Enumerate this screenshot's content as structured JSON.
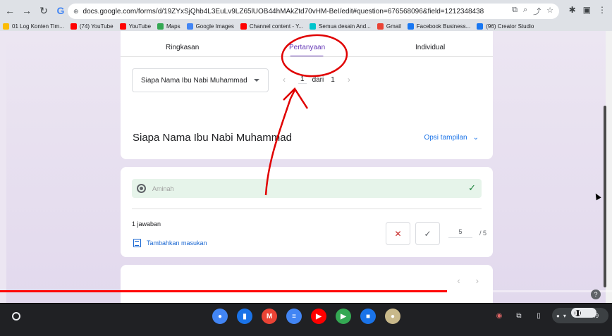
{
  "browser": {
    "url": "docs.google.com/forms/d/19ZYxSjQhb4L3EuLv9LZ65lUOB44hMAkZtd70vHM-BeI/edit#question=676568096&field=1212348438",
    "nav_icons": [
      "back-arrow-icon",
      "forward-arrow-icon",
      "reload-icon",
      "info-icon"
    ],
    "bookmarks": [
      {
        "label": "01 Log Konten Tim...",
        "icon": "drive-icon",
        "color": "#fbbc04"
      },
      {
        "label": "(74) YouTube",
        "icon": "youtube-icon",
        "color": "#ff0000"
      },
      {
        "label": "YouTube",
        "icon": "youtube-icon",
        "color": "#ff0000"
      },
      {
        "label": "Maps",
        "icon": "maps-icon",
        "color": "#34a853"
      },
      {
        "label": "Google Images",
        "icon": "google-icon",
        "color": "#4285f4"
      },
      {
        "label": "Channel content - Y...",
        "icon": "youtube-icon",
        "color": "#ff0000"
      },
      {
        "label": "Semua desain And...",
        "icon": "canva-icon",
        "color": "#00c4cc"
      },
      {
        "label": "Gmail",
        "icon": "gmail-icon",
        "color": "#ea4335"
      },
      {
        "label": "Facebook Business...",
        "icon": "facebook-icon",
        "color": "#1877f2"
      },
      {
        "label": "(96) Creator Studio",
        "icon": "creator-studio-icon",
        "color": "#1877f2"
      }
    ]
  },
  "form": {
    "tabs": [
      "Ringkasan",
      "Pertanyaan",
      "Individual"
    ],
    "active_tab": "Pertanyaan",
    "question_select": "Siapa Nama Ibu Nabi Muhammad",
    "pager": {
      "current": "1",
      "of_label": "dari",
      "total": "1"
    },
    "question_title": "Siapa Nama Ibu Nabi Muhammad",
    "display_options": "Opsi tampilan",
    "answer": "Aminah",
    "response_count": "1 jawaban",
    "add_feedback": "Tambahkan masukan",
    "score": {
      "value": "5",
      "max": "/ 5"
    }
  },
  "video": {
    "progress": 0.73
  },
  "shelf": {
    "apps": [
      {
        "name": "chrome-app-icon",
        "color": "#4285f4",
        "glyph": "●"
      },
      {
        "name": "files-app-icon",
        "color": "#1a73e8",
        "glyph": "▮"
      },
      {
        "name": "gmail-app-icon",
        "color": "#ea4335",
        "glyph": "M"
      },
      {
        "name": "docs-app-icon",
        "color": "#4285f4",
        "glyph": "≡"
      },
      {
        "name": "youtube-app-icon",
        "color": "#ff0000",
        "glyph": "▶"
      },
      {
        "name": "play-store-app-icon",
        "color": "#34a853",
        "glyph": "▶"
      },
      {
        "name": "meet-app-icon",
        "color": "#1a73e8",
        "glyph": "■"
      },
      {
        "name": "other-app-icon",
        "color": "#c8b88a",
        "glyph": "●"
      }
    ],
    "time": "10.49"
  },
  "colors": {
    "accent": "#673ab7",
    "link": "#1a73e8",
    "annotation": "#e00000",
    "progress": "#ff0000"
  }
}
